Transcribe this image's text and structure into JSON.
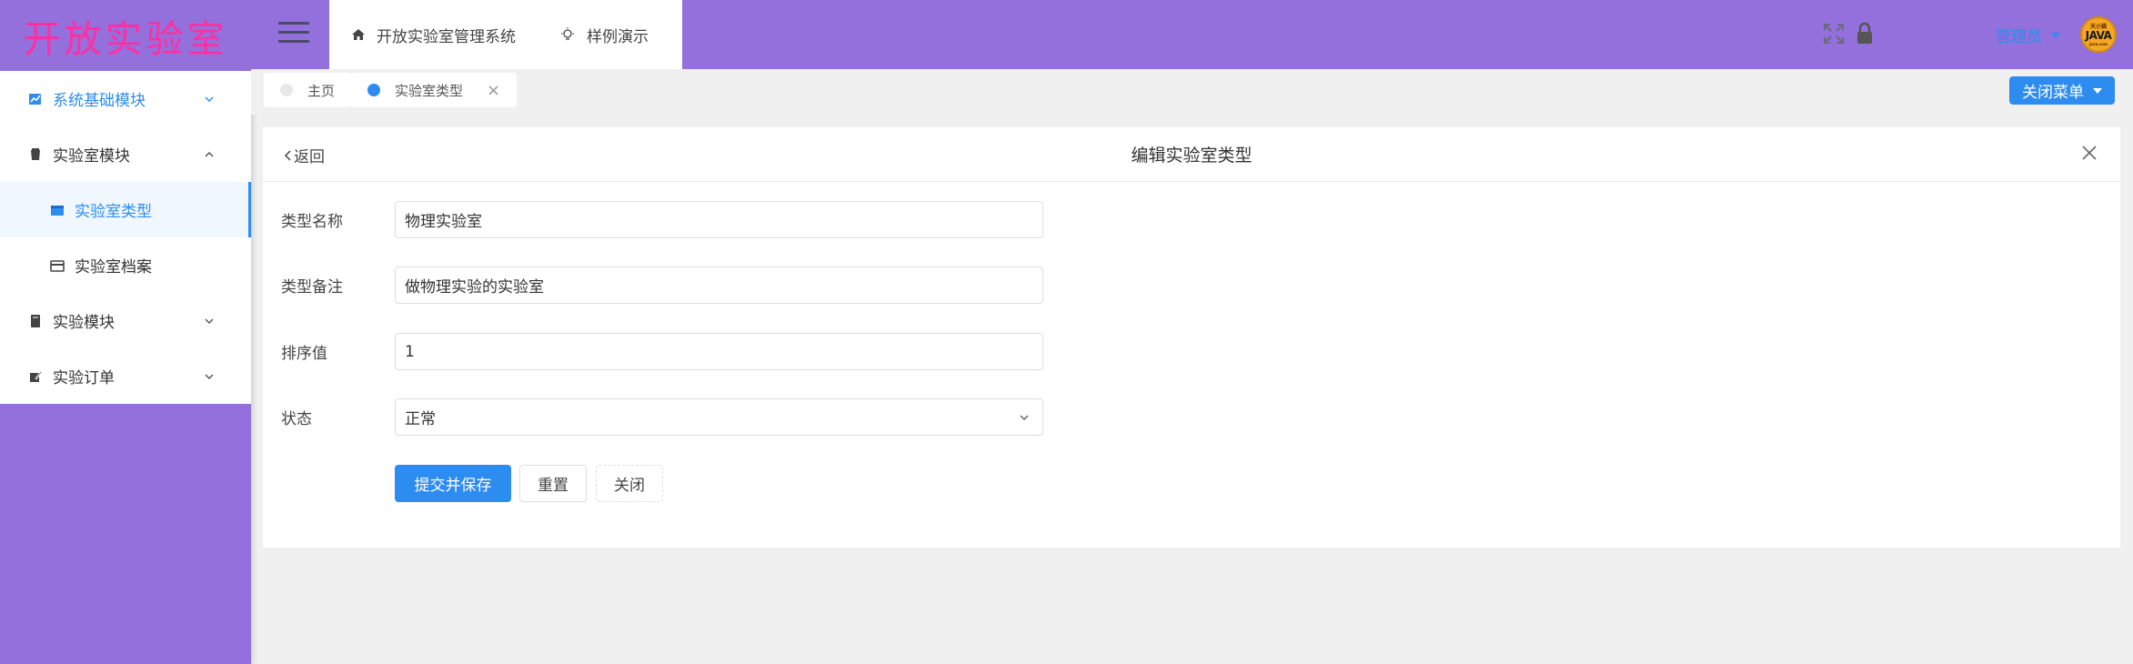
{
  "app": {
    "logo_text": "开放实验室",
    "brand_color": "#9370db",
    "accent_color": "#2d8cf0",
    "logo_color": "#ff2fa3"
  },
  "header": {
    "nav_items": [
      {
        "label": "开放实验室管理系统",
        "icon": "home-icon"
      },
      {
        "label": "样例演示",
        "icon": "lightbulb-icon"
      }
    ],
    "user_name": "管理员",
    "avatar_text": {
      "top": "天小猫",
      "main": "JAVA",
      "bottom": "java.com"
    }
  },
  "sidebar": {
    "items": [
      {
        "label": "系统基础模块",
        "icon": "chart-icon",
        "expanded": false
      },
      {
        "label": "实验室模块",
        "icon": "lab-icon",
        "expanded": true
      },
      {
        "label": "实验室类型",
        "icon": "folder-icon",
        "active": true
      },
      {
        "label": "实验室档案",
        "icon": "card-icon"
      },
      {
        "label": "实验模块",
        "icon": "book-icon",
        "expanded": false
      },
      {
        "label": "实验订单",
        "icon": "edit-icon",
        "expanded": false
      }
    ]
  },
  "tabs": {
    "items": [
      {
        "label": "主页",
        "dot_color": "#e8e8e8"
      },
      {
        "label": "实验室类型",
        "dot_color": "#2d8cf0",
        "closable": true
      }
    ],
    "close_menu_label": "关闭菜单"
  },
  "page": {
    "back_label": "返回",
    "title": "编辑实验室类型"
  },
  "form": {
    "name_label": "类型名称",
    "name_value": "物理实验室",
    "remark_label": "类型备注",
    "remark_value": "做物理实验的实验室",
    "sort_label": "排序值",
    "sort_value": "1",
    "status_label": "状态",
    "status_value": "正常"
  },
  "buttons": {
    "submit_label": "提交并保存",
    "reset_label": "重置",
    "close_label": "关闭"
  }
}
